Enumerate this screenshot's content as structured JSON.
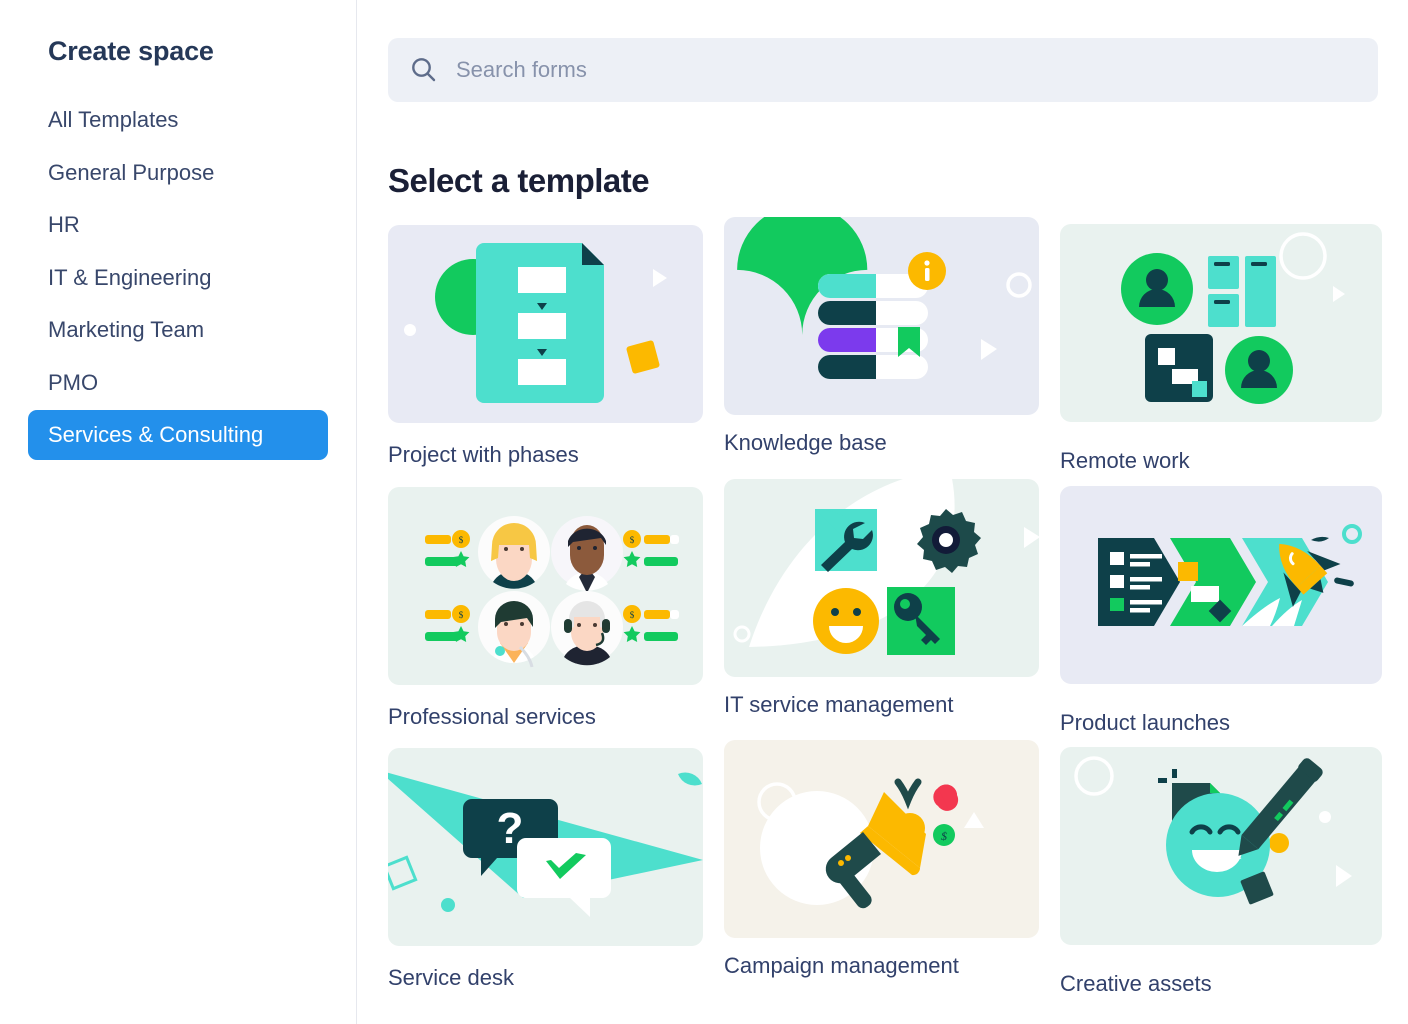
{
  "sidebar": {
    "title": "Create space",
    "items": [
      {
        "label": "All Templates",
        "active": false
      },
      {
        "label": "General Purpose",
        "active": false
      },
      {
        "label": "HR",
        "active": false
      },
      {
        "label": "IT & Engineering",
        "active": false
      },
      {
        "label": "Marketing Team",
        "active": false
      },
      {
        "label": "PMO",
        "active": false
      },
      {
        "label": "Services & Consulting",
        "active": true
      }
    ]
  },
  "search": {
    "placeholder": "Search forms",
    "value": "",
    "icon": "search-icon"
  },
  "main": {
    "heading": "Select a template",
    "templates": [
      {
        "label": "Project with phases",
        "illustration": "project-with-phases",
        "bg": "#e8eaf4"
      },
      {
        "label": "Knowledge base",
        "illustration": "knowledge-base",
        "bg": "#e7eaf3"
      },
      {
        "label": "Remote work",
        "illustration": "remote-work",
        "bg": "#e9f2ef"
      },
      {
        "label": "Professional services",
        "illustration": "professional-services",
        "bg": "#e9f2ef"
      },
      {
        "label": "IT service management",
        "illustration": "it-service-management",
        "bg": "#e9f2ef"
      },
      {
        "label": "Product launches",
        "illustration": "product-launches",
        "bg": "#e8eaf4"
      },
      {
        "label": "Service desk",
        "illustration": "service-desk",
        "bg": "#e9f2ef"
      },
      {
        "label": "Campaign management",
        "illustration": "campaign-management",
        "bg": "#f5f2ea"
      },
      {
        "label": "Creative assets",
        "illustration": "creative-assets",
        "bg": "#e9f2ef"
      }
    ]
  },
  "colors": {
    "accent_blue": "#2390eb",
    "green": "#12ca5e",
    "teal": "#4ddfcd",
    "dark_navy": "#0e4049",
    "yellow": "#fcb900",
    "purple": "#7c3aed",
    "red": "#f3374f",
    "text_dark": "#253858",
    "card_label": "#32416b",
    "search_bg": "#edf0f6"
  }
}
